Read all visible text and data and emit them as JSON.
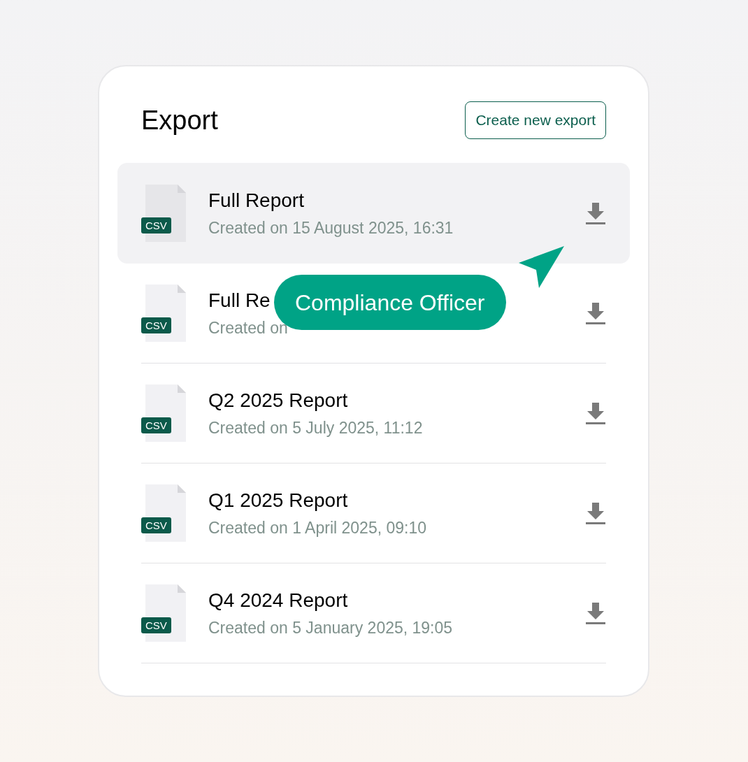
{
  "panel": {
    "title": "Export",
    "create_button": "Create new export"
  },
  "exports": [
    {
      "badge": "CSV",
      "name": "Full Report",
      "created": "Created on 15 August 2025, 16:31",
      "selected": true
    },
    {
      "badge": "CSV",
      "name": "Full Re",
      "created": "Created on",
      "selected": false
    },
    {
      "badge": "CSV",
      "name": "Q2 2025 Report",
      "created": "Created on 5 July 2025, 11:12",
      "selected": false
    },
    {
      "badge": "CSV",
      "name": "Q1 2025 Report",
      "created": "Created on 1 April 2025, 09:10",
      "selected": false
    },
    {
      "badge": "CSV",
      "name": "Q4 2024 Report",
      "created": "Created on 5 January 2025, 19:05",
      "selected": false
    }
  ],
  "cursor_label": {
    "text": "Compliance Officer"
  }
}
